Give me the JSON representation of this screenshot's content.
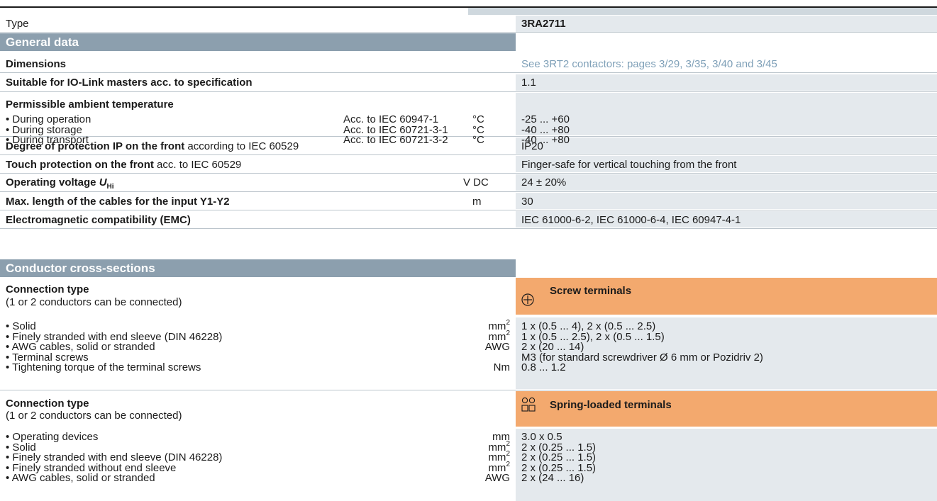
{
  "type_row": {
    "label": "Type",
    "value": "3RA2711"
  },
  "general_data": {
    "header": "General data",
    "dimensions": {
      "label": "Dimensions",
      "value": "See 3RT2 contactors: pages 3/29, 3/35, 3/40 and 3/45"
    },
    "io_link": {
      "label": "Suitable for IO-Link masters acc. to specification",
      "value": "1.1"
    },
    "ambient_temperature": {
      "label": "Permissible ambient temperature",
      "items": [
        {
          "label": "• During operation",
          "standard": "Acc. to IEC 60947-1",
          "unit": "°C",
          "value": "-25 ... +60"
        },
        {
          "label": "• During storage",
          "standard": "Acc. to IEC 60721-3-1",
          "unit": "°C",
          "value": "-40 ... +80"
        },
        {
          "label": "• During transport",
          "standard": "Acc. to IEC 60721-3-2",
          "unit": "°C",
          "value": "-40 ... +80"
        }
      ]
    },
    "degree_protection": {
      "label_bold": "Degree of protection IP on the front",
      "label_rest": " according to IEC 60529",
      "value": "IP20"
    },
    "touch_protection": {
      "label_bold": "Touch protection on the front",
      "label_rest": " acc. to IEC 60529",
      "value": "Finger-safe for vertical touching from the front"
    },
    "operating_voltage": {
      "label": "Operating voltage ",
      "symbol": "U",
      "subscript": "Hi",
      "unit": "V DC",
      "value": "24 ± 20%"
    },
    "cable_length": {
      "label": "Max. length of the cables for the input Y1-Y2",
      "unit": "m",
      "value": "30"
    },
    "emc": {
      "label": "Electromagnetic compatibility (EMC)",
      "value": "IEC 61000-6-2, IEC 61000-6-4, IEC 60947-4-1"
    }
  },
  "conductor": {
    "header": "Conductor cross-sections",
    "screw": {
      "title": "Connection type",
      "subtitle": "(1 or 2 conductors can be connected)",
      "terminal_label": "Screw terminals",
      "icon": "screw-terminal-icon",
      "items": [
        {
          "label": "• Solid",
          "unit": "mm",
          "sup": "2",
          "value": "1 x (0.5 ... 4), 2 x (0.5 ... 2.5)"
        },
        {
          "label": "• Finely stranded with end sleeve (DIN 46228)",
          "unit": "mm",
          "sup": "2",
          "value": "1 x (0.5 ... 2.5), 2 x (0.5 ... 1.5)"
        },
        {
          "label": "• AWG cables, solid or stranded",
          "unit": "AWG",
          "sup": "",
          "value": "2 x (20 ... 14)"
        },
        {
          "label": "• Terminal screws",
          "unit": "",
          "sup": "",
          "value": "M3 (for standard screwdriver Ø 6 mm or Pozidriv 2)"
        },
        {
          "label": "• Tightening torque of the terminal screws",
          "unit": "Nm",
          "sup": "",
          "value": "0.8 ... 1.2"
        }
      ]
    },
    "spring": {
      "title": "Connection type",
      "subtitle": "(1 or 2 conductors can be connected)",
      "terminal_label": "Spring-loaded terminals",
      "icon": "spring-terminal-icon",
      "items": [
        {
          "label": "• Operating devices",
          "unit": "mm",
          "sup": "",
          "value": "3.0 x 0.5"
        },
        {
          "label": "• Solid",
          "unit": "mm",
          "sup": "2",
          "value": "2 x (0.25 ... 1.5)"
        },
        {
          "label": "• Finely stranded with end sleeve (DIN 46228)",
          "unit": "mm",
          "sup": "2",
          "value": "2 x (0.25 ... 1.5)"
        },
        {
          "label": "• Finely stranded without end sleeve",
          "unit": "mm",
          "sup": "2",
          "value": "2 x (0.25 ... 1.5)"
        },
        {
          "label": "• AWG cables, solid or stranded",
          "unit": "AWG",
          "sup": "",
          "value": "2 x (24 ... 16)"
        }
      ]
    }
  },
  "colors": {
    "header_bg": "#8c9fae",
    "value_bg": "#e4e9ed",
    "terminal_bg": "#f3a96e",
    "link": "#7fa0b8"
  }
}
